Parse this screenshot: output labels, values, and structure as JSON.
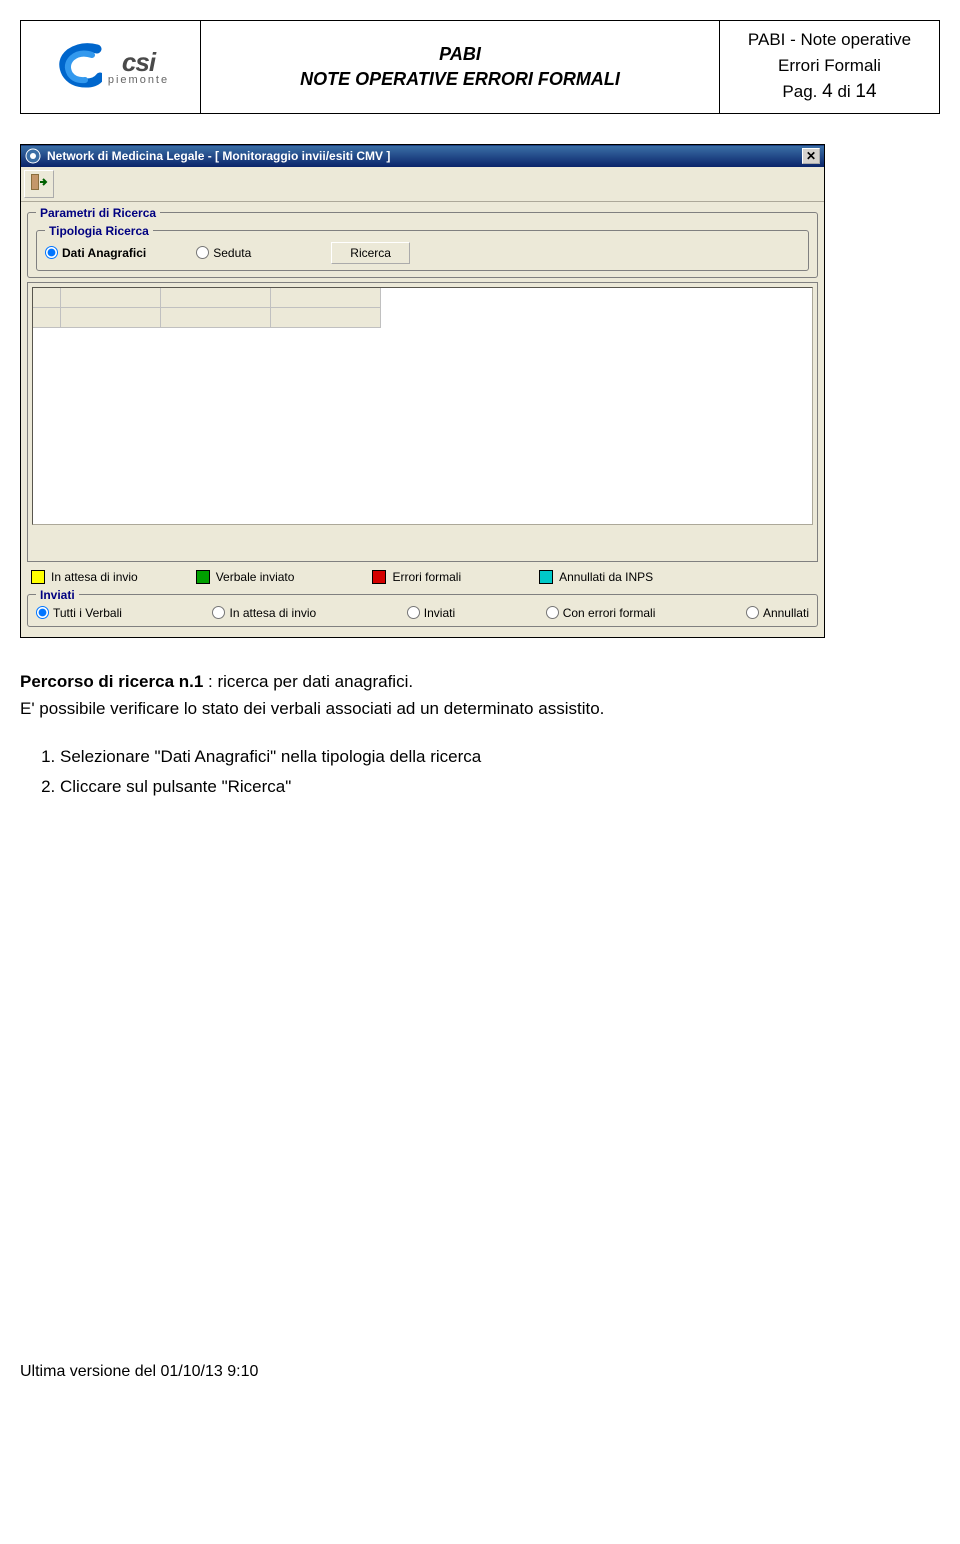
{
  "header": {
    "logo_text": "csi",
    "logo_sub": "piemonte",
    "title_line1": "PABI",
    "title_line2": "NOTE OPERATIVE ERRORI FORMALI",
    "info_line1": "PABI - Note operative",
    "info_line2": "Errori Formali",
    "page_prefix": "Pag.",
    "page_current": "4",
    "page_sep": "di",
    "page_total": "14"
  },
  "window": {
    "title": "Network di Medicina Legale - [ Monitoraggio invii/esiti CMV ]",
    "params_legend": "Parametri di Ricerca",
    "type_legend": "Tipologia Ricerca",
    "radio_dati": "Dati Anagrafici",
    "radio_seduta": "Seduta",
    "search_btn": "Ricerca",
    "legend": {
      "attesa": "In attesa di invio",
      "inviato": "Verbale inviato",
      "errori": "Errori formali",
      "annullati": "Annullati da INPS"
    },
    "inviati_legend": "Inviati",
    "filter": {
      "tutti": "Tutti i Verbali",
      "attesa": "In attesa di invio",
      "inviati": "Inviati",
      "errori": "Con errori formali",
      "annullati": "Annullati"
    }
  },
  "body": {
    "caption": "Percorso di ricerca n.1",
    "caption_after": " : ricerca per dati anagrafici.",
    "para": "E' possibile verificare lo stato dei verbali associati ad un determinato assistito.",
    "step1": "Selezionare \"Dati Anagrafici\" nella tipologia della ricerca",
    "step2": "Cliccare sul pulsante \"Ricerca\""
  },
  "footer": {
    "text": "Ultima versione del 01/10/13 9:10"
  }
}
